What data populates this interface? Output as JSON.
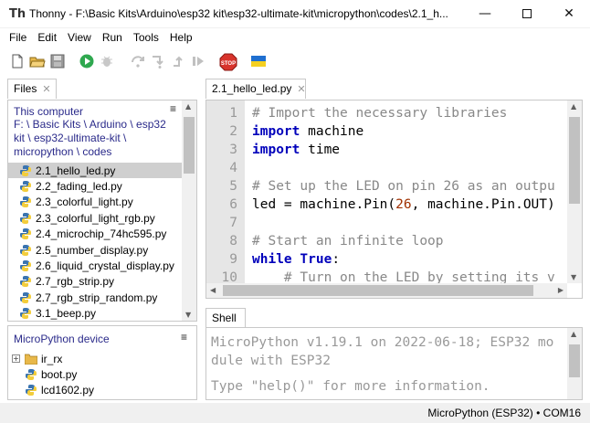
{
  "window": {
    "title": "Thonny  -  F:\\Basic Kits\\Arduino\\esp32 kit\\esp32-ultimate-kit\\micropython\\codes\\2.1_h...",
    "app_icon": "Th",
    "minimize": "—",
    "close": "✕"
  },
  "menu": [
    "File",
    "Edit",
    "View",
    "Run",
    "Tools",
    "Help"
  ],
  "toolbar": {
    "icons": [
      "new-file-icon",
      "open-file-icon",
      "save-icon",
      "run-icon",
      "debug-icon",
      "step-over-icon",
      "step-into-icon",
      "step-out-icon",
      "resume-icon",
      "stop-icon",
      "ukraine-flag-icon"
    ],
    "stop_label": "STOP"
  },
  "files": {
    "tab_label": "Files",
    "tab_close": "✕",
    "section_title": "This computer",
    "menu_glyph": "≡",
    "path_lines": [
      "F: \\ Basic Kits \\ Arduino \\ esp32",
      "kit \\ esp32-ultimate-kit \\",
      "micropython \\ codes"
    ],
    "items": [
      {
        "name": "2.1_hello_led.py",
        "selected": true
      },
      {
        "name": "2.2_fading_led.py"
      },
      {
        "name": "2.3_colorful_light.py"
      },
      {
        "name": "2.3_colorful_light_rgb.py"
      },
      {
        "name": "2.4_microchip_74hc595.py"
      },
      {
        "name": "2.5_number_display.py"
      },
      {
        "name": "2.6_liquid_crystal_display.py"
      },
      {
        "name": "2.7_rgb_strip.py"
      },
      {
        "name": "2.7_rgb_strip_random.py"
      },
      {
        "name": "3.1_beep.py"
      }
    ]
  },
  "device": {
    "title": "MicroPython device",
    "menu_glyph": "≡",
    "items": [
      {
        "name": "ir_rx",
        "type": "folder",
        "expander": "+"
      },
      {
        "name": "boot.py",
        "type": "file"
      },
      {
        "name": "lcd1602.py",
        "type": "file"
      }
    ]
  },
  "editor": {
    "tab_label": "2.1_hello_led.py",
    "tab_close": "✕",
    "line_numbers": [
      "1",
      "2",
      "3",
      "4",
      "5",
      "6",
      "7",
      "8",
      "9",
      "10"
    ],
    "lines": [
      [
        {
          "t": "# Import the necessary libraries",
          "c": "comment"
        }
      ],
      [
        {
          "t": "import",
          "c": "kw"
        },
        {
          "t": " machine",
          "c": ""
        }
      ],
      [
        {
          "t": "import",
          "c": "kw"
        },
        {
          "t": " time",
          "c": ""
        }
      ],
      [
        {
          "t": "",
          "c": ""
        }
      ],
      [
        {
          "t": "# Set up the LED on pin 26 as an outpu",
          "c": "comment"
        }
      ],
      [
        {
          "t": "led = machine.Pin(",
          "c": ""
        },
        {
          "t": "26",
          "c": "num"
        },
        {
          "t": ", machine.Pin.OUT)",
          "c": ""
        }
      ],
      [
        {
          "t": "",
          "c": ""
        }
      ],
      [
        {
          "t": "# Start an infinite loop",
          "c": "comment"
        }
      ],
      [
        {
          "t": "while",
          "c": "kw"
        },
        {
          "t": " ",
          "c": ""
        },
        {
          "t": "True",
          "c": "kw"
        },
        {
          "t": ":",
          "c": ""
        }
      ],
      [
        {
          "t": "    # Turn on the LED by setting its v",
          "c": "comment"
        }
      ]
    ]
  },
  "shell": {
    "tab_label": "Shell",
    "lines": [
      "MicroPython v1.19.1 on 2022-06-18; ESP32 mo",
      "dule with ESP32",
      "",
      "Type \"help()\" for more information."
    ]
  },
  "status": {
    "text": "MicroPython (ESP32)  •  COM16"
  }
}
